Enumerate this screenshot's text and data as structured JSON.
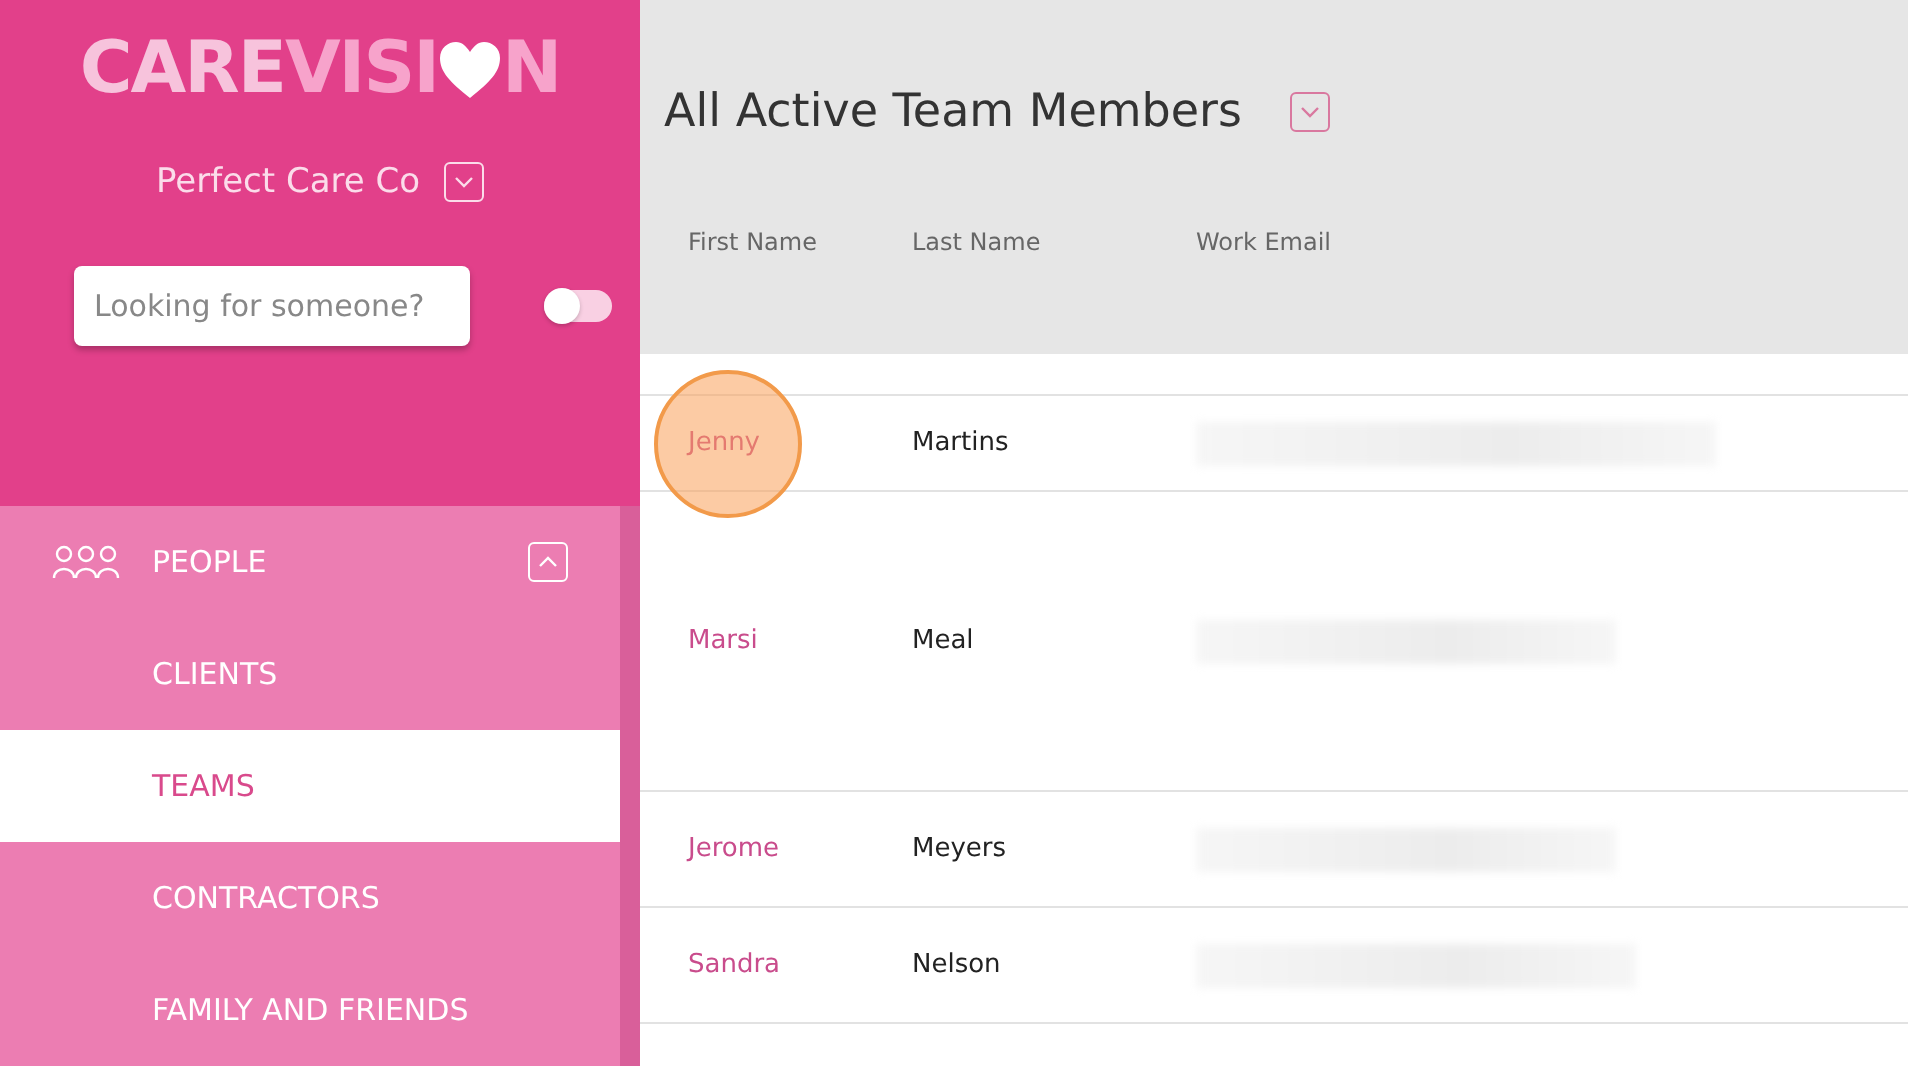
{
  "sidebar": {
    "logo": {
      "part_1": "CARE",
      "part_2": "VISI",
      "part_3": "N"
    },
    "organization": "Perfect Care Co",
    "search": {
      "placeholder": "Looking for someone?",
      "toggle_on": false
    },
    "section": {
      "label": "PEOPLE",
      "expanded": true
    },
    "items": [
      {
        "label": "CLIENTS",
        "selected": false
      },
      {
        "label": "TEAMS",
        "selected": true
      },
      {
        "label": "CONTRACTORS",
        "selected": false
      },
      {
        "label": "FAMILY AND FRIENDS",
        "selected": false
      }
    ]
  },
  "main": {
    "title": "All Active Team Members",
    "table": {
      "columns": [
        "First Name",
        "Last Name",
        "Work Email"
      ],
      "rows": [
        {
          "first_name": "Jenny",
          "last_name": "Martins",
          "highlighted": true
        },
        {
          "first_name": "Marsi",
          "last_name": "Meal",
          "highlighted": false
        },
        {
          "first_name": "Jerome",
          "last_name": "Meyers",
          "highlighted": false
        },
        {
          "first_name": "Sandra",
          "last_name": "Nelson",
          "highlighted": false
        }
      ]
    }
  }
}
